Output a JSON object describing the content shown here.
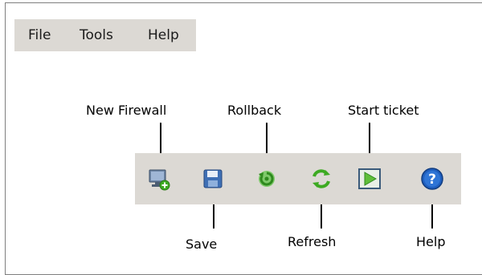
{
  "menubar": {
    "items": [
      "File",
      "Tools",
      "Help"
    ]
  },
  "toolbar": {
    "buttons": [
      {
        "label": "New Firewall",
        "icon": "computer-add-icon"
      },
      {
        "label": "Save",
        "icon": "floppy-disk-icon"
      },
      {
        "label": "Rollback",
        "icon": "rollback-icon"
      },
      {
        "label": "Refresh",
        "icon": "refresh-icon"
      },
      {
        "label": "Start ticket",
        "icon": "play-icon"
      },
      {
        "label": "Help",
        "icon": "help-circle-icon"
      }
    ]
  },
  "colors": {
    "bar_background": "#dcd9d4",
    "border": "#7f7f7f",
    "refresh_green": "#3daa22",
    "help_blue": "#1f5fbf"
  }
}
